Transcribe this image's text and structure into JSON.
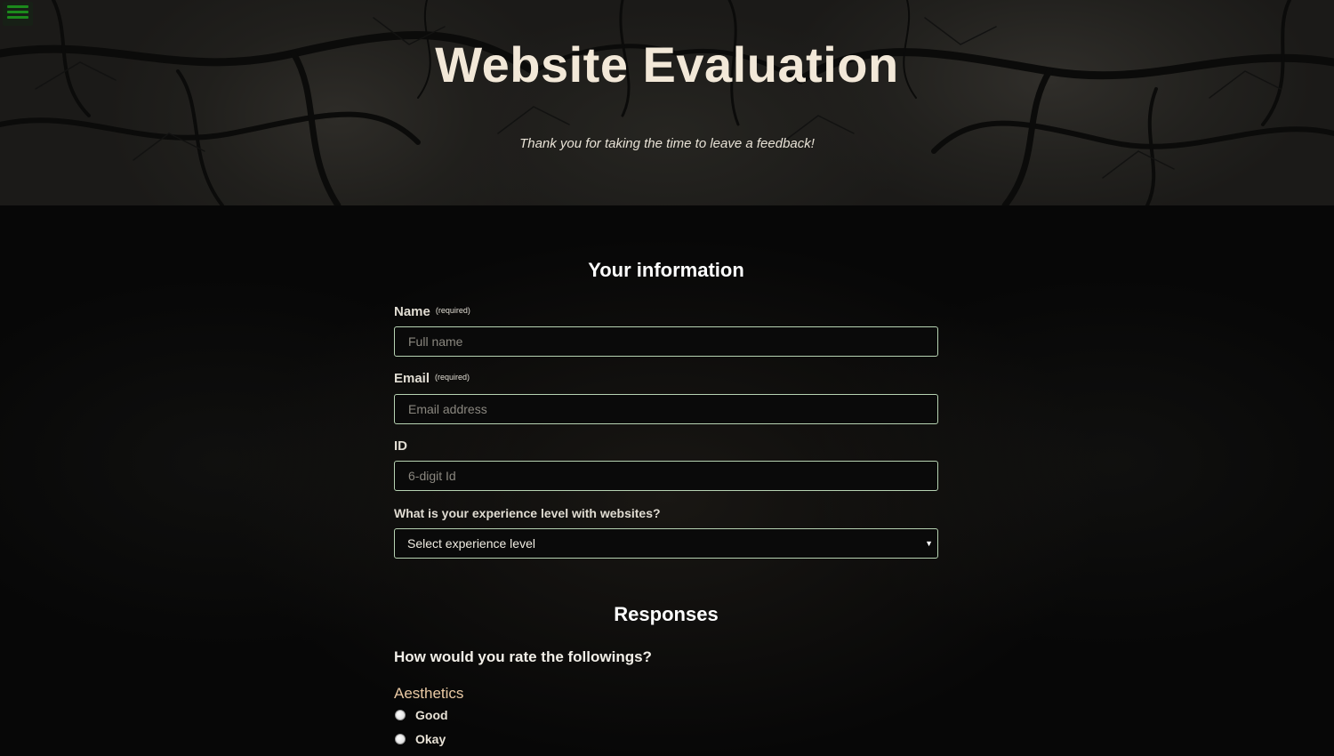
{
  "header": {
    "menu_icon": "hamburger-menu-icon",
    "title": "Website Evaluation",
    "subtitle": "Thank you for taking the time to leave a feedback!"
  },
  "info_section": {
    "title": "Your information",
    "required_tag": "(required)",
    "name": {
      "label": "Name",
      "placeholder": "Full name",
      "value": ""
    },
    "email": {
      "label": "Email",
      "placeholder": "Email address",
      "value": ""
    },
    "id": {
      "label": "ID",
      "placeholder": "6-digit Id",
      "value": ""
    },
    "experience": {
      "label": "What is your experience level with websites?",
      "selected": "Select experience level"
    }
  },
  "responses_section": {
    "title": "Responses",
    "question": "How would you rate the followings?",
    "category": "Aesthetics",
    "options": [
      "Good",
      "Okay"
    ]
  },
  "colors": {
    "menu_accent": "#1c8a1c",
    "input_border": "#b7d3b3",
    "category_text": "#e9c9a4",
    "title_text": "#f2e8d8"
  }
}
